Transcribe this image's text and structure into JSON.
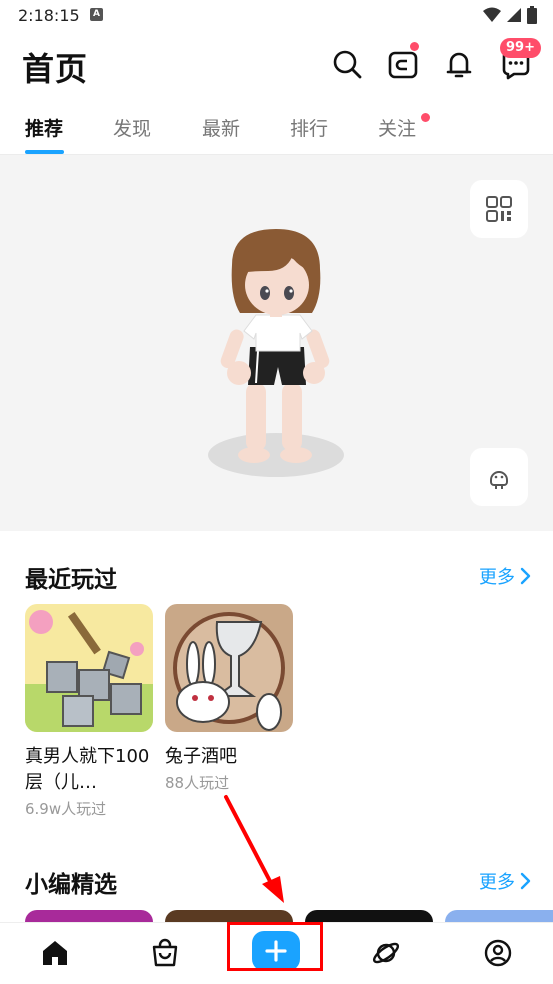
{
  "status_bar": {
    "time": "2:18:15",
    "notif_letter": "A"
  },
  "header": {
    "title": "首页",
    "messages_badge": "99+"
  },
  "tabs": [
    {
      "label": "推荐",
      "active": true
    },
    {
      "label": "发现",
      "active": false
    },
    {
      "label": "最新",
      "active": false
    },
    {
      "label": "排行",
      "active": false
    },
    {
      "label": "关注",
      "active": false,
      "dot": true
    }
  ],
  "recent": {
    "title": "最近玩过",
    "more_label": "更多",
    "games": [
      {
        "name": "真男人就下100层（儿…",
        "plays": "6.9w人玩过"
      },
      {
        "name": "兔子酒吧",
        "plays": "88人玩过"
      }
    ]
  },
  "picks": {
    "title": "小编精选",
    "more_label": "更多"
  },
  "colors": {
    "accent": "#1aa3ff",
    "badge": "#ff4d6a",
    "annotation": "#ff0000"
  }
}
